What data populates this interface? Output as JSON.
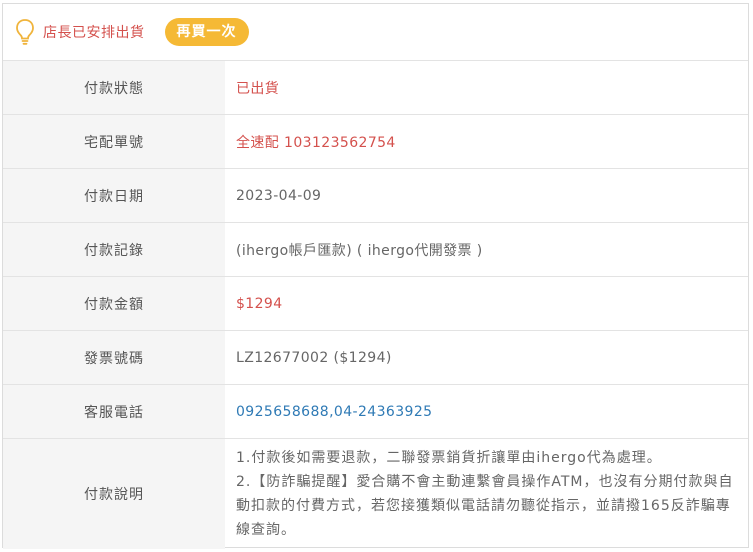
{
  "header": {
    "status_text": "店長已安排出貨",
    "reorder_label": "再買一次",
    "icon": "lightbulb-icon"
  },
  "rows": {
    "payment_status": {
      "label": "付款狀態",
      "value": "已出貨"
    },
    "tracking_number": {
      "label": "宅配單號",
      "value": "全速配 103123562754"
    },
    "payment_date": {
      "label": "付款日期",
      "value": "2023-04-09"
    },
    "payment_record": {
      "label": "付款記錄",
      "value": "(ihergo帳戶匯款) ( ihergo代開發票 )"
    },
    "payment_amount": {
      "label": "付款金額",
      "value": "$1294"
    },
    "invoice_number": {
      "label": "發票號碼",
      "value": "LZ12677002 ($1294)"
    },
    "service_phone": {
      "label": "客服電話",
      "value": "0925658688,04-24363925"
    },
    "payment_notes": {
      "label": "付款說明",
      "line1": "1.付款後如需要退款，二聯發票銷貨折讓單由ihergo代為處理。",
      "line2": "2.【防詐騙提醒】愛合購不會主動連繫會員操作ATM，也沒有分期付款與自動扣款的付費方式，若您接獲類似電話請勿聽從指示，並請撥165反詐騙專線查詢。"
    }
  },
  "colors": {
    "accent_red": "#d4514d",
    "button_yellow": "#f5b935",
    "link_blue": "#2f7ab5",
    "label_bg": "#f5f5f5"
  }
}
